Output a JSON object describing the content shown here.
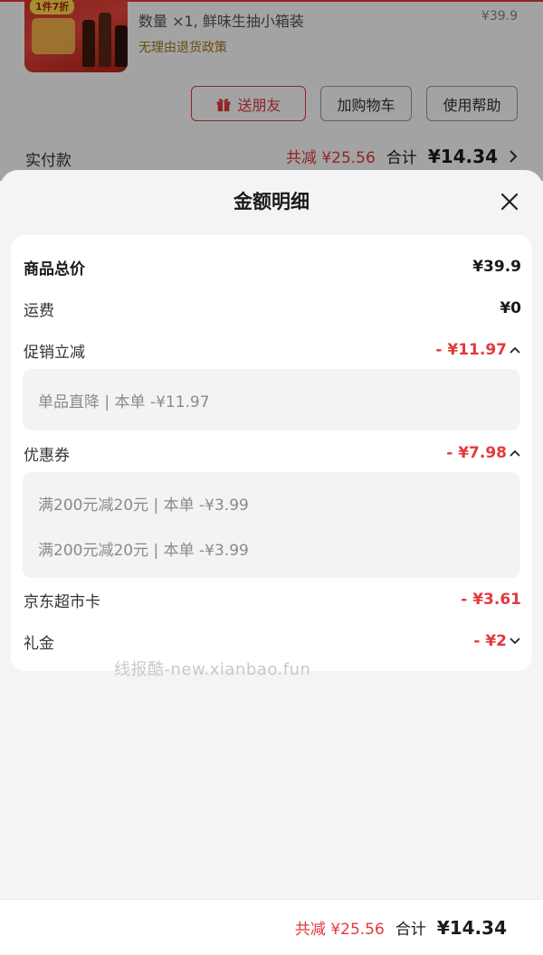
{
  "background": {
    "product": {
      "image_tag": "1件7折",
      "quantity_text": "数量 ×1, 鲜味生抽小箱装",
      "price": "¥39.9",
      "policy": "无理由退货政策"
    },
    "buttons": {
      "gift": "送朋友",
      "cart": "加购物车",
      "help": "使用帮助"
    },
    "paid_label": "实付款",
    "total_discount": "共减 ¥25.56",
    "total_label": "合计",
    "total_amount": "¥14.34"
  },
  "sheet": {
    "title": "金额明细",
    "rows": {
      "goods_total": {
        "label": "商品总价",
        "value": "¥39.9"
      },
      "shipping": {
        "label": "运费",
        "value": "¥0"
      },
      "promo": {
        "label": "促销立减",
        "value": "- ¥11.97"
      },
      "coupon": {
        "label": "优惠券",
        "value": "- ¥7.98"
      },
      "jd_card": {
        "label": "京东超市卡",
        "value": "- ¥3.61"
      },
      "gift_money": {
        "label": "礼金",
        "value": "- ¥2"
      }
    },
    "promo_details": [
      "单品直降 | 本单 -¥11.97"
    ],
    "coupon_details": [
      "满200元减20元 | 本单 -¥3.99",
      "满200元减20元 | 本单 -¥3.99"
    ],
    "watermark": "线报酷-new.xianbao.fun"
  },
  "bottom_bar": {
    "total_discount": "共减 ¥25.56",
    "total_label": "合计",
    "total_amount": "¥14.34"
  },
  "colors": {
    "accent": "#e4393c",
    "sheet_bg": "#f4f4f4",
    "card_bg": "#ffffff"
  },
  "icons": [
    "gift-icon",
    "chevron-right-icon",
    "close-icon",
    "chevron-up-icon",
    "chevron-down-icon"
  ]
}
